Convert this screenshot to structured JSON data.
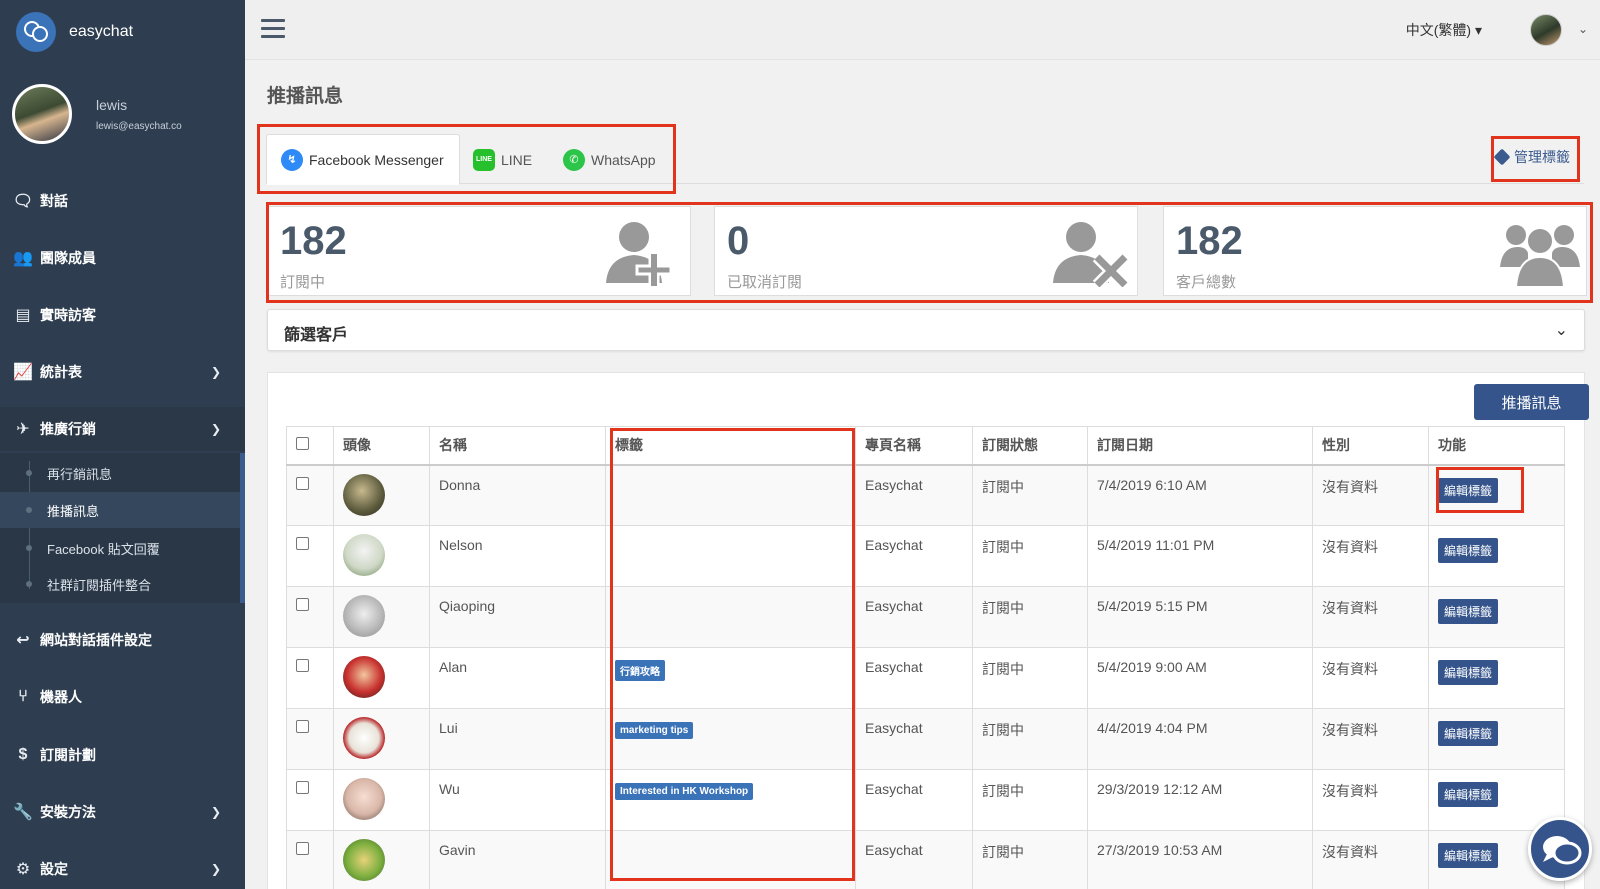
{
  "sidebar": {
    "brand": "easychat",
    "user": {
      "name": "lewis",
      "email": "lewis@easychat.co"
    },
    "items": [
      {
        "label": "對話",
        "icon": "chat-icon",
        "glyph": "🗨"
      },
      {
        "label": "團隊成員",
        "icon": "users-icon",
        "glyph": "👥"
      },
      {
        "label": "實時訪客",
        "icon": "id-card-icon",
        "glyph": "▤"
      },
      {
        "label": "統計表",
        "icon": "line-chart-icon",
        "glyph": "📈"
      },
      {
        "label": "推廣行銷",
        "icon": "paper-plane-icon",
        "glyph": "✈"
      },
      {
        "label": "網站對話插件設定",
        "icon": "reply-icon",
        "glyph": "↩"
      },
      {
        "label": "機器人",
        "icon": "branch-icon",
        "glyph": "⑂"
      },
      {
        "label": "訂閱計劃",
        "icon": "dollar-icon",
        "glyph": "$"
      },
      {
        "label": "安裝方法",
        "icon": "wrench-icon",
        "glyph": "🔧"
      },
      {
        "label": "設定",
        "icon": "gear-icon",
        "glyph": "⚙"
      }
    ],
    "submenu": [
      "再行銷訊息",
      "推播訊息",
      "Facebook 貼文回覆",
      "社群訂閱插件整合"
    ]
  },
  "topbar": {
    "language": "中文(繁體)"
  },
  "page": {
    "title": "推播訊息",
    "tabs": [
      "Facebook Messenger",
      "LINE",
      "WhatsApp"
    ],
    "manage_tags": "管理標籤",
    "push_button": "推播訊息",
    "filter_label": "篩選客戶"
  },
  "stats": [
    {
      "value": "182",
      "label": "訂閱中",
      "icon": "user-plus-icon"
    },
    {
      "value": "0",
      "label": "已取消訂閱",
      "icon": "user-times-icon"
    },
    {
      "value": "182",
      "label": "客戶總數",
      "icon": "users-group-icon"
    }
  ],
  "table": {
    "headers": [
      "頭像",
      "名稱",
      "標籤",
      "專頁名稱",
      "訂閱狀態",
      "訂閱日期",
      "性別",
      "功能"
    ],
    "edit_label": "編輯標籤",
    "rows": [
      {
        "name": "Donna",
        "tag": "",
        "page": "Easychat",
        "status": "訂閱中",
        "date": "7/4/2019 6:10 AM",
        "gender": "沒有資料"
      },
      {
        "name": "Nelson",
        "tag": "",
        "page": "Easychat",
        "status": "訂閱中",
        "date": "5/4/2019 11:01 PM",
        "gender": "沒有資料"
      },
      {
        "name": "Qiaoping",
        "tag": "",
        "page": "Easychat",
        "status": "訂閱中",
        "date": "5/4/2019 5:15 PM",
        "gender": "沒有資料"
      },
      {
        "name": "Alan",
        "tag": "行銷攻略",
        "page": "Easychat",
        "status": "訂閱中",
        "date": "5/4/2019 9:00 AM",
        "gender": "沒有資料"
      },
      {
        "name": "Lui",
        "tag": "marketing tips",
        "page": "Easychat",
        "status": "訂閱中",
        "date": "4/4/2019 4:04 PM",
        "gender": "沒有資料"
      },
      {
        "name": "Wu",
        "tag": "Interested in HK Workshop",
        "page": "Easychat",
        "status": "訂閱中",
        "date": "29/3/2019 12:12 AM",
        "gender": "沒有資料"
      },
      {
        "name": "Gavin",
        "tag": "",
        "page": "Easychat",
        "status": "訂閱中",
        "date": "27/3/2019 10:53 AM",
        "gender": "沒有資料"
      }
    ]
  },
  "colors": {
    "sidebar": "#2e3e50",
    "primary": "#34548b",
    "tag": "#3b73b9",
    "highlight": "#e2341d"
  }
}
